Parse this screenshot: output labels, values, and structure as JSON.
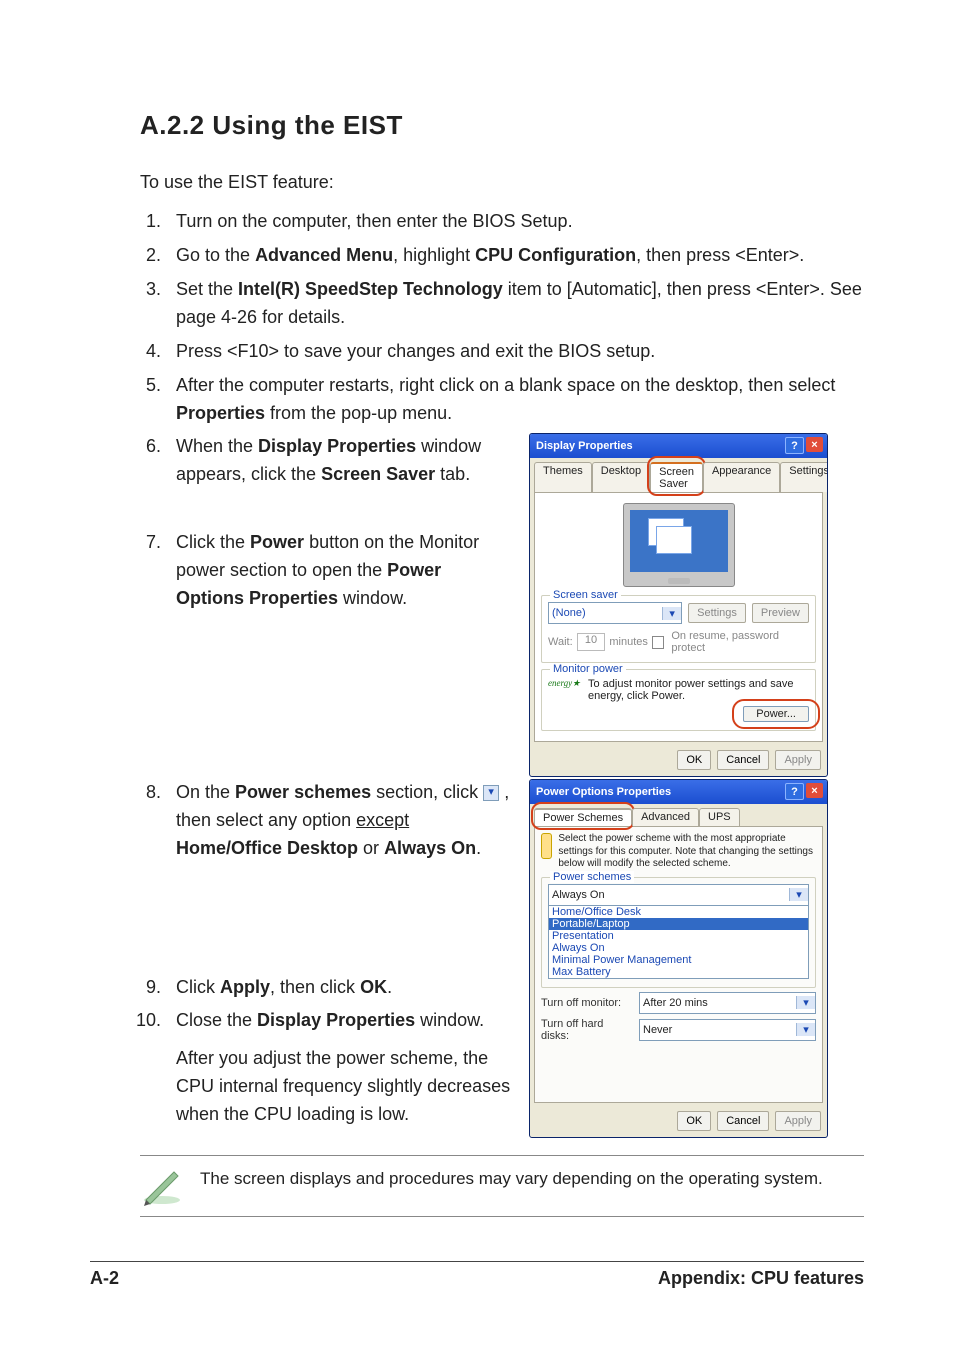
{
  "heading": "A.2.2   Using the EIST",
  "lead": "To use the EIST feature:",
  "steps": {
    "s1": "Turn on the computer, then enter the BIOS Setup.",
    "s2a": "Go to the ",
    "s2b": "Advanced Menu",
    "s2c": ", highlight ",
    "s2d": "CPU Configuration",
    "s2e": ", then press <Enter>.",
    "s3a": "Set the ",
    "s3b": "Intel(R) SpeedStep Technology",
    "s3c": " item to [Automatic], then press <Enter>. See page 4-26 for details.",
    "s4": "Press <F10> to save your changes and exit the BIOS setup.",
    "s5a": "After the computer restarts, right click on a blank space on the desktop, then select ",
    "s5b": "Properties",
    "s5c": " from the pop-up menu.",
    "s6a": "When the ",
    "s6b": "Display Properties",
    "s6c": " window appears, click the ",
    "s6d": "Screen Saver",
    "s6e": " tab.",
    "s7a": "Click the ",
    "s7b": "Power",
    "s7c": " button on the Monitor power section to open the ",
    "s7d": "Power Options Properties",
    "s7e": " window.",
    "s8a": "On the ",
    "s8b": "Power schemes",
    "s8c": " section, click ",
    "s8d": ", then select any option ",
    "s8e": "except",
    "s8f": " Home/Office Desktop",
    "s8g": " or ",
    "s8h": "Always On",
    "s8i": ".",
    "s9a": "Click ",
    "s9b": "Apply",
    "s9c": ", then click ",
    "s9d": "OK",
    "s9e": ".",
    "s10a": "Close the ",
    "s10b": "Display Properties",
    "s10c": " window.",
    "after": "After you adjust the power scheme, the CPU internal frequency slightly decreases when the CPU loading is low."
  },
  "note": "The screen displays and procedures may vary depending on the operating system.",
  "footer_left": "A-2",
  "footer_right": "Appendix: CPU features",
  "dp": {
    "title": "Display Properties",
    "tabs": [
      "Themes",
      "Desktop",
      "Screen Saver",
      "Appearance",
      "Settings"
    ],
    "grp_saver": "Screen saver",
    "saver_value": "(None)",
    "btn_settings": "Settings",
    "btn_preview": "Preview",
    "wait": "Wait:",
    "wait_val": "10",
    "wait_min": "minutes",
    "resume": "On resume, password protect",
    "grp_mon": "Monitor power",
    "mon_text": "To adjust monitor power settings and save energy, click Power.",
    "btn_power": "Power...",
    "ok": "OK",
    "cancel": "Cancel",
    "apply": "Apply"
  },
  "po": {
    "title": "Power Options Properties",
    "tabs": [
      "Power Schemes",
      "Advanced",
      "UPS"
    ],
    "desc": "Select the power scheme with the most appropriate settings for this computer. Note that changing the settings below will modify the selected scheme.",
    "grp": "Power schemes",
    "sel": "Always On",
    "opts": [
      "Home/Office Desk",
      "Portable/Laptop",
      "Presentation",
      "Always On",
      "Minimal Power Management",
      "Max Battery"
    ],
    "turn_mon": "Turn off monitor:",
    "turn_mon_v": "After 20 mins",
    "turn_hd": "Turn off hard disks:",
    "turn_hd_v": "Never",
    "ok": "OK",
    "cancel": "Cancel",
    "apply": "Apply"
  }
}
